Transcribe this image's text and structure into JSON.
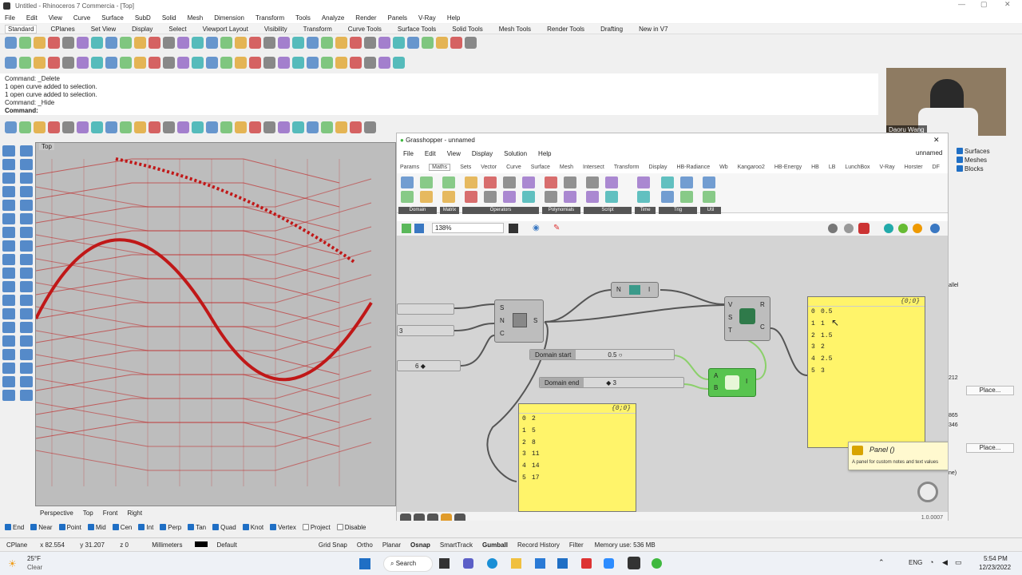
{
  "window": {
    "title": "Untitled - Rhinoceros 7 Commercia - [Top]"
  },
  "menu": [
    "File",
    "Edit",
    "View",
    "Curve",
    "Surface",
    "SubD",
    "Solid",
    "Mesh",
    "Dimension",
    "Transform",
    "Tools",
    "Analyze",
    "Render",
    "Panels",
    "V-Ray",
    "Help"
  ],
  "tabs": [
    {
      "label": "Standard",
      "active": true
    },
    {
      "label": "CPlanes"
    },
    {
      "label": "Set View"
    },
    {
      "label": "Display"
    },
    {
      "label": "Select"
    },
    {
      "label": "Viewport Layout"
    },
    {
      "label": "Visibility"
    },
    {
      "label": "Transform"
    },
    {
      "label": "Curve Tools"
    },
    {
      "label": "Surface Tools"
    },
    {
      "label": "Solid Tools"
    },
    {
      "label": "Mesh Tools"
    },
    {
      "label": "Render Tools"
    },
    {
      "label": "Drafting"
    },
    {
      "label": "New in V7"
    }
  ],
  "command": {
    "history": [
      "Command: _Delete",
      "1 open curve added to selection.",
      "1 open curve added to selection.",
      "Command: _Hide"
    ],
    "prompt": "Command:"
  },
  "viewport": {
    "label": "Top",
    "tabs": [
      "Perspective",
      "Top",
      "Front",
      "Right"
    ]
  },
  "osnap": [
    {
      "label": "End",
      "on": true
    },
    {
      "label": "Near",
      "on": true
    },
    {
      "label": "Point",
      "on": true
    },
    {
      "label": "Mid",
      "on": true
    },
    {
      "label": "Cen",
      "on": true
    },
    {
      "label": "Int",
      "on": true
    },
    {
      "label": "Perp",
      "on": true
    },
    {
      "label": "Tan",
      "on": true
    },
    {
      "label": "Quad",
      "on": true
    },
    {
      "label": "Knot",
      "on": true
    },
    {
      "label": "Vertex",
      "on": true
    },
    {
      "label": "Project",
      "on": false
    },
    {
      "label": "Disable",
      "on": false
    }
  ],
  "status": {
    "cplane": "CPlane",
    "x": "x 82.554",
    "y": "y 31.207",
    "z": "z 0",
    "units": "Millimeters",
    "layer": "Default",
    "toggles": [
      "Grid Snap",
      "Ortho",
      "Planar",
      "Osnap",
      "SmartTrack",
      "Gumball",
      "Record History",
      "Filter"
    ],
    "memory": "Memory use: 536 MB"
  },
  "taskbar": {
    "weather_temp": "25°F",
    "weather_desc": "Clear",
    "search": "Search",
    "lang": "ENG",
    "time": "5:54 PM",
    "date": "12/23/2022"
  },
  "webcam": {
    "name": "Daoru Wang"
  },
  "rightpanel": {
    "items": [
      "Surfaces",
      "Meshes",
      "Blocks"
    ],
    "buttons": [
      "Place...",
      "Place..."
    ],
    "side": [
      "allel",
      "212",
      "865",
      "346",
      "ne)"
    ]
  },
  "grasshopper": {
    "title": "Grasshopper - unnamed",
    "doc": "unnamed",
    "menu": [
      "File",
      "Edit",
      "View",
      "Display",
      "Solution",
      "Help"
    ],
    "tabs": [
      {
        "label": "Params"
      },
      {
        "label": "Maths",
        "active": true
      },
      {
        "label": "Sets"
      },
      {
        "label": "Vector"
      },
      {
        "label": "Curve"
      },
      {
        "label": "Surface"
      },
      {
        "label": "Mesh"
      },
      {
        "label": "Intersect"
      },
      {
        "label": "Transform"
      },
      {
        "label": "Display"
      },
      {
        "label": "HB-Radiance"
      },
      {
        "label": "Wb"
      },
      {
        "label": "Kangaroo2"
      },
      {
        "label": "HB-Energy"
      },
      {
        "label": "HB"
      },
      {
        "label": "LB"
      },
      {
        "label": "LunchBox"
      },
      {
        "label": "V-Ray"
      },
      {
        "label": "Horster"
      },
      {
        "label": "DF"
      }
    ],
    "sections": [
      "Domain",
      "Matrix",
      "Operators",
      "Polynomials",
      "Script",
      "Time",
      "Trig",
      "Util"
    ],
    "zoom": "138%",
    "version": "1.0.0007",
    "components": {
      "series": {
        "inputs": [
          "S",
          "N",
          "C"
        ],
        "output": "S"
      },
      "neg": {
        "left": "N",
        "right": "I"
      },
      "remap": {
        "inputs": [
          "V",
          "S",
          "T"
        ],
        "outputs": [
          "R",
          "C"
        ]
      },
      "construct": {
        "inputs": [
          "A",
          "B"
        ],
        "output": "I"
      }
    },
    "sliders": [
      {
        "name": "Domain start",
        "value": "0.5"
      },
      {
        "name": "Domain end",
        "value": "3"
      },
      {
        "name": "",
        "value": "6"
      },
      {
        "name": "",
        "value": "3"
      }
    ],
    "panel_left": {
      "header": "{0;0}",
      "rows": [
        {
          "i": "0",
          "v": "2"
        },
        {
          "i": "1",
          "v": "5"
        },
        {
          "i": "2",
          "v": "8"
        },
        {
          "i": "3",
          "v": "11"
        },
        {
          "i": "4",
          "v": "14"
        },
        {
          "i": "5",
          "v": "17"
        }
      ]
    },
    "panel_right": {
      "header": "{0;0}",
      "rows": [
        {
          "i": "0",
          "v": "0.5"
        },
        {
          "i": "1",
          "v": "1"
        },
        {
          "i": "2",
          "v": "1.5"
        },
        {
          "i": "3",
          "v": "2"
        },
        {
          "i": "4",
          "v": "2.5"
        },
        {
          "i": "5",
          "v": "3"
        }
      ]
    },
    "tooltip": {
      "title": "Panel ()",
      "desc": "A panel for custom notes and text values"
    }
  },
  "colors": {
    "accent": "#1f6fc5",
    "curve_red": "#c01818",
    "panel_yellow": "#fff46a",
    "gh_green": "#3fb83f"
  }
}
